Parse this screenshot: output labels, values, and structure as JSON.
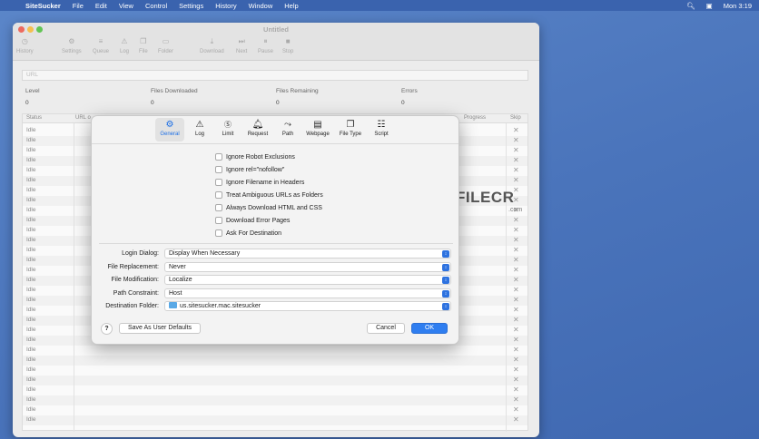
{
  "menubar": {
    "app_name": "SiteSucker",
    "items": [
      "File",
      "Edit",
      "View",
      "Control",
      "Settings",
      "History",
      "Window",
      "Help"
    ],
    "clock": "Mon 3:19"
  },
  "window": {
    "title": "Untitled",
    "toolbar": [
      "History",
      "Settings",
      "Queue",
      "Log",
      "File",
      "Folder",
      "Download",
      "Next",
      "Pause",
      "Stop"
    ],
    "url_placeholder": "URL",
    "stats": [
      {
        "label": "Level",
        "value": "0"
      },
      {
        "label": "Files Downloaded",
        "value": "0"
      },
      {
        "label": "Files Remaining",
        "value": "0"
      },
      {
        "label": "Errors",
        "value": "0"
      }
    ],
    "table_headers": {
      "status": "Status",
      "url": "URL o",
      "progress": "Progress",
      "skip": "Skip"
    },
    "row_status": "Idle"
  },
  "dialog": {
    "tabs": [
      "General",
      "Log",
      "Limit",
      "Request",
      "Path",
      "Webpage",
      "File Type",
      "Script"
    ],
    "active_tab": "General",
    "checkboxes": [
      "Ignore Robot Exclusions",
      "Ignore rel=\"nofollow\"",
      "Ignore Filename in Headers",
      "Treat Ambiguous URLs as Folders",
      "Always Download HTML and CSS",
      "Download Error Pages",
      "Ask For Destination"
    ],
    "popups": [
      {
        "label": "Login Dialog:",
        "value": "Display When Necessary"
      },
      {
        "label": "File Replacement:",
        "value": "Never"
      },
      {
        "label": "File Modification:",
        "value": "Localize"
      },
      {
        "label": "Path Constraint:",
        "value": "Host"
      },
      {
        "label": "Destination Folder:",
        "value": "us.sitesucker.mac.sitesucker"
      }
    ],
    "help_label": "?",
    "defaults_label": "Save As User Defaults",
    "cancel_label": "Cancel",
    "ok_label": "OK"
  },
  "watermark": {
    "text": "FILECR",
    "sub": ".com"
  },
  "colors": {
    "accent": "#2f7ef0",
    "desktop": "#4a74bb"
  }
}
